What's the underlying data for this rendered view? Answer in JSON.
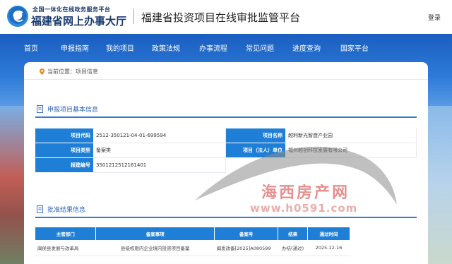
{
  "header": {
    "logo_top": "全国一体化在线政务服务平台",
    "logo_main": "福建省网上办事大厅",
    "site_title": "福建省投资项目在线审批监管平台",
    "login": "登录"
  },
  "nav": {
    "items": [
      "首页",
      "申报指南",
      "我的项目",
      "政策法规",
      "办事流程",
      "常见问题",
      "进度查询",
      "国家平台"
    ]
  },
  "breadcrumb": {
    "prefix": "当前位置：",
    "current": "项目信息"
  },
  "basic_info": {
    "section_title": "申报项目基本信息",
    "fields": [
      {
        "label": "项目代码",
        "value": "2512-350121-04-01-699594"
      },
      {
        "label": "项目名称",
        "value": "越利新光智造产业园"
      },
      {
        "label": "项目类型",
        "value": "备案类"
      },
      {
        "label": "项目（法人）单位",
        "value": "福州越创科技发展有限公司"
      },
      {
        "label": "报建编号",
        "value": "3501212512161401"
      }
    ]
  },
  "approval": {
    "section_title": "批准结果信息",
    "columns": [
      "主管部门",
      "备案事项",
      "备案号",
      "结果",
      "通过时间"
    ],
    "rows": [
      [
        "闽侯县发展与改革局",
        "县级权限内企业境内投资项目备案",
        "闽发改备[2025]A080599",
        "办结(通过)",
        "2025-12-16"
      ]
    ]
  },
  "watermark": {
    "title": "海西房产网",
    "url": "www.h0591.com"
  },
  "colors": {
    "nav_blue": "#1a5ec0",
    "header_cell_blue": "#1f7fd6",
    "section_title_blue": "#2f66b3",
    "watermark_red": "#e06a6a"
  }
}
